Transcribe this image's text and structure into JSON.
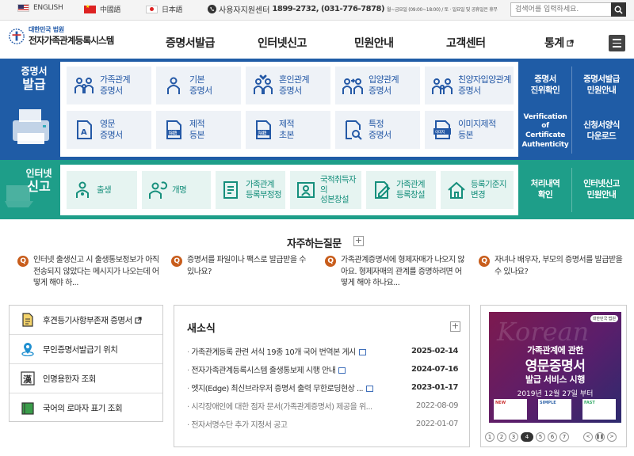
{
  "topbar": {
    "languages": [
      {
        "label": "ENGLISH",
        "flag": "us-flag-icon"
      },
      {
        "label": "中國語",
        "flag": "china-flag-icon"
      },
      {
        "label": "日本語",
        "flag": "japan-flag-icon"
      }
    ],
    "phone_label": "사용자지원센터",
    "phone_numbers": "1899-2732, (031-776-7878)",
    "phone_hours": "월~금요일 (09:00~18:00) / 토 · 일요일 및 공휴일은 휴무",
    "search_placeholder": "검색어를 입력하세요."
  },
  "header": {
    "org": "대한민국 법원",
    "title": "전자가족관계등록시스템",
    "nav": [
      "증명서발급",
      "인터넷신고",
      "민원안내",
      "고객센터",
      "통계"
    ]
  },
  "issuance": {
    "label_line1": "증명서",
    "label_line2": "발급",
    "tiles": [
      {
        "line1": "가족관계",
        "line2": "증명서"
      },
      {
        "line1": "기본",
        "line2": "증명서"
      },
      {
        "line1": "혼인관계",
        "line2": "증명서"
      },
      {
        "line1": "입양관계",
        "line2": "증명서"
      },
      {
        "line1": "친양자입양관계",
        "line2": "증명서"
      },
      {
        "line1": "영문",
        "line2": "증명서"
      },
      {
        "line1": "제적",
        "line2": "등본"
      },
      {
        "line1": "제적",
        "line2": "초본"
      },
      {
        "line1": "특정",
        "line2": "증명서"
      },
      {
        "line1": "이미지제적",
        "line2": "등본"
      }
    ],
    "side": [
      {
        "line1": "증명서",
        "line2": "진위확인"
      },
      {
        "line1": "증명서발급",
        "line2": "민원안내"
      },
      {
        "line1": "Verification of",
        "line2": "Certificate",
        "line3": "Authenticity"
      },
      {
        "line1": "신청서양식",
        "line2": "다운로드"
      }
    ]
  },
  "report": {
    "label_line1": "인터넷",
    "label_line2": "신고",
    "tiles": [
      {
        "line1": "출생",
        "line2": ""
      },
      {
        "line1": "개명",
        "line2": ""
      },
      {
        "line1": "가족관계",
        "line2": "등록부정정"
      },
      {
        "line1": "국적취득자의",
        "line2": "성본창설"
      },
      {
        "line1": "가족관계",
        "line2": "등록창설"
      },
      {
        "line1": "등록기준지",
        "line2": "변경"
      }
    ],
    "side": [
      {
        "line1": "처리내역",
        "line2": "확인"
      },
      {
        "line1": "인터넷신고",
        "line2": "민원안내"
      }
    ]
  },
  "faq": {
    "title": "자주하는질문",
    "items": [
      "인터넷 출생신고 시 출생통보정보가 아직 전송되지 않았다는 메시지가 나오는데 어떻게 해야 하...",
      "증명서를 파일이나 팩스로 발급받을 수 있나요?",
      "가족관계증명서에 형제자매가 나오지 않아요. 형제자매의 관계를 증명하려면 어떻게 해야 하나요...",
      "자녀나 배우자, 부모의 증명서를 발급받을 수 있나요?"
    ]
  },
  "quick": [
    {
      "label": "후견등기사항부존재 증명서",
      "icon": "document-icon"
    },
    {
      "label": "무인증명서발급기 위치",
      "icon": "location-pin-icon"
    },
    {
      "label": "인명용한자 조회",
      "icon": "hanja-icon"
    },
    {
      "label": "국어의 로마자 표기 조회",
      "icon": "book-icon"
    }
  ],
  "news": {
    "title": "새소식",
    "items": [
      {
        "title": "가족관계등록 관련 서식 19종 10개 국어 번역본 게시",
        "date": "2025-02-14"
      },
      {
        "title": "전자가족관계등록시스템 출생통보제 시행 안내",
        "date": "2024-07-16"
      },
      {
        "title": "엣지(Edge) 최신브라우저 증명서 출력 무한로딩현상 ...",
        "date": "2023-01-17"
      },
      {
        "title": "시각장애인에 대한 점자 문서(가족관계증명서) 제공을 위...",
        "date": "2022-08-09"
      },
      {
        "title": "전자서명수단 추가 지정서 공고",
        "date": "2022-01-07"
      }
    ]
  },
  "banner": {
    "org": "대한민국 법원",
    "line1": "가족관계에 관한",
    "line2": "영문증명서",
    "line3": "발급 서비스 시행",
    "line4": "2019년 12월 27일 부터",
    "cards": [
      "NEW",
      "SIMPLE",
      "FAST"
    ],
    "pages": [
      "1",
      "2",
      "3",
      "4",
      "5",
      "6",
      "7"
    ],
    "current_page": "4"
  },
  "colors": {
    "issuance_band": "#1f5ca6",
    "report_band": "#1e9e89",
    "faq_badge": "#c85d1c"
  }
}
